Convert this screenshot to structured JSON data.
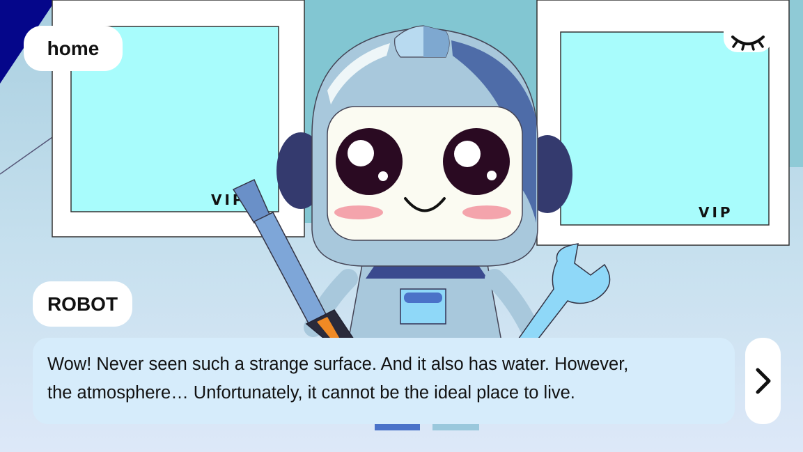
{
  "nav": {
    "home_label": "home"
  },
  "hud": {
    "hide_ui_icon": "closed-eye-icon",
    "next_icon": "chevron-right-icon"
  },
  "scene": {
    "left_panel_label": "VIP",
    "right_panel_label": "VIP",
    "character_icon": "robot-character",
    "left_tool_icon": "screwdriver-icon",
    "right_tool_icon": "wrench-icon"
  },
  "dialog": {
    "speaker": "ROBOT",
    "line1": "Wow! Never seen such a strange surface. And it also has water. However,",
    "line2": "the atmosphere… Unfortunately, it cannot be the ideal place to live."
  },
  "colors": {
    "panel_screen": "#a8fcfc",
    "dialog_bg": "#d6ecfb",
    "corner": "#05068a",
    "robot_body": "#a8c8dc",
    "robot_ear": "#343a6e"
  }
}
